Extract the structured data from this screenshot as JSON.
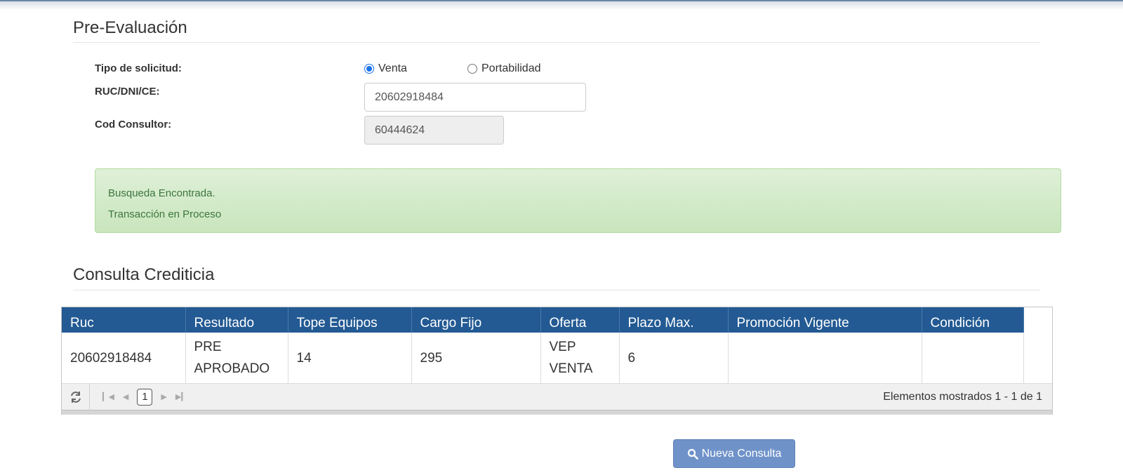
{
  "pre_evaluacion": {
    "title": "Pre-Evaluación",
    "tipo_label": "Tipo de solicitud:",
    "ruc_label": "RUC/DNI/CE:",
    "cod_label": "Cod Consultor:",
    "options": [
      {
        "label": "Venta",
        "checked": true
      },
      {
        "label": "Portabilidad",
        "checked": false
      }
    ],
    "ruc_value": "20602918484",
    "cod_value": "60444624"
  },
  "alert": {
    "line1": "Busqueda Encontrada.",
    "line2": "Transacción en Proceso",
    "color": "#3c763d"
  },
  "consulta": {
    "title": "Consulta Crediticia",
    "columns": [
      "Ruc",
      "Resultado",
      "Tope Equipos",
      "Cargo Fijo",
      "Oferta",
      "Plazo Max.",
      "Promoción Vigente",
      "Condición"
    ],
    "rows": [
      [
        "20602918484",
        "PRE APROBADO",
        "14",
        "295",
        "VEP VENTA",
        "6",
        "",
        ""
      ]
    ],
    "header_color": "#235a93",
    "pager": {
      "current_page": "1",
      "info": "Elementos mostrados 1 - 1 de 1"
    }
  },
  "actions": {
    "nueva_consulta": "Nueva Consulta",
    "button_color": "#6f92c9"
  }
}
